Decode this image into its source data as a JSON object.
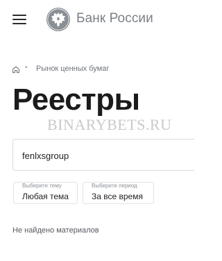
{
  "header": {
    "menu_icon": "hamburger-menu-icon",
    "logo_icon": "double-headed-eagle-emblem",
    "bank_name": "Банк России"
  },
  "breadcrumb": {
    "home_icon": "home-icon",
    "items": [
      "Рынок ценных бумаг"
    ]
  },
  "page_title": "Реестры",
  "watermark": "BINARYBETS.RU",
  "search": {
    "value": "fenlxsgroup"
  },
  "filters": {
    "topic": {
      "caption": "Выберите тему",
      "value": "Любая тема"
    },
    "period": {
      "caption": "Выберите период",
      "value": "За все время"
    }
  },
  "empty_message": "Не найдено материалов",
  "colors": {
    "text": "#1b1b1b",
    "muted": "#7b7f84",
    "border": "#d7dadd"
  }
}
